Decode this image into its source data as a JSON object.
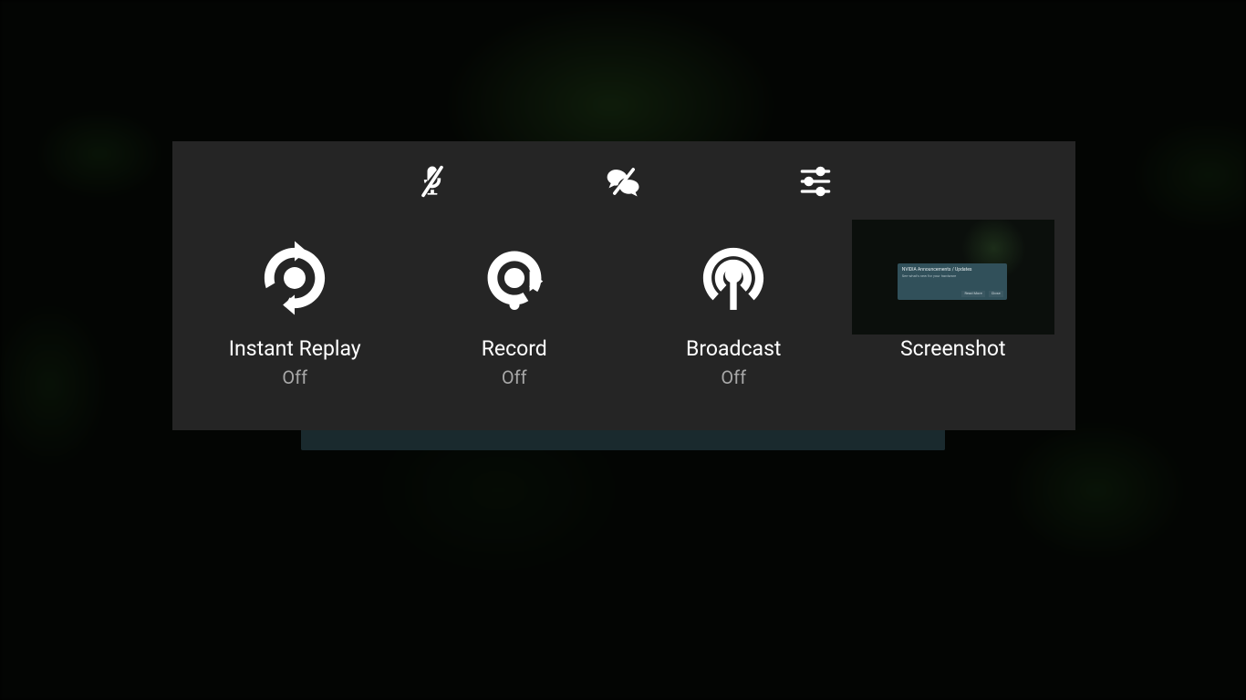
{
  "toolbar": {
    "mic_icon": "microphone-muted-icon",
    "chat_icon": "chat-disabled-icon",
    "settings_icon": "sliders-icon"
  },
  "features": {
    "instant_replay": {
      "label": "Instant Replay",
      "status": "Off"
    },
    "record": {
      "label": "Record",
      "status": "Off"
    },
    "broadcast": {
      "label": "Broadcast",
      "status": "Off"
    },
    "screenshot": {
      "label": "Screenshot"
    }
  },
  "screenshot_preview": {
    "title": "NVIDIA Announcements / Updates",
    "subtitle": "See what's new for your hardware",
    "button_left": "Read More",
    "button_right": "Close"
  }
}
